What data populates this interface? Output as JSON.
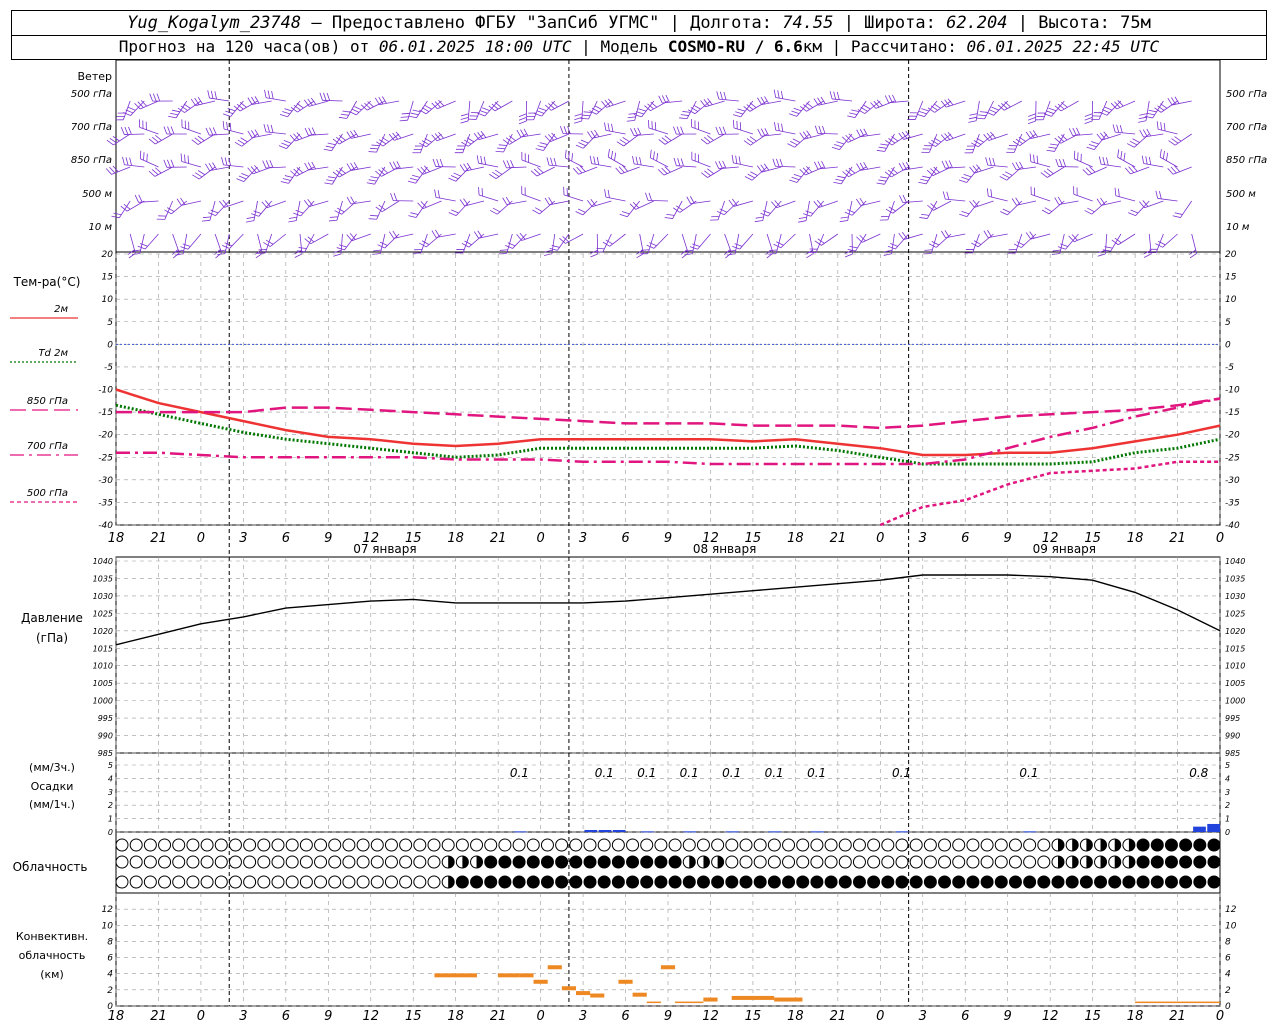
{
  "header": {
    "station": "Yug_Kogalym_23748",
    "dash": "–",
    "provider": "Предоставлено ФГБУ \"ЗапСиб УГМС\"",
    "lon_label": "Долгота:",
    "lon": "74.55",
    "lat_label": "Широта:",
    "lat": "62.204",
    "alt_label": "Высота:",
    "alt": "75м",
    "forecast_label": "Прогноз на 120 часа(ов) от",
    "forecast_time": "06.01.2025 18:00 UTC",
    "model_label": "Модель",
    "model": "COSMO-RU / 6.6",
    "model_unit": "км",
    "calc_label": "Рассчитано:",
    "calc_time": "06.01.2025 22:45 UTC"
  },
  "colors": {
    "temp_2m": "#ee3333",
    "dewpoint_2m": "#007700",
    "temp_upper": "#e0157f",
    "wind": "#7a2fd0",
    "pressure": "#000000",
    "precip": "#2244dd",
    "convective": "#ee8822",
    "zero_line": "#3355cc",
    "grid": "#999999"
  },
  "chart_data": [
    {
      "type": "wind_barbs",
      "title": "Ветер",
      "levels": [
        "500 гПа",
        "700 гПа",
        "850 гПа",
        "500 м",
        "10 м"
      ]
    },
    {
      "type": "line",
      "title": "Тем-ра(°C)",
      "ylim": [
        -40,
        20
      ],
      "yticks": [
        20,
        15,
        10,
        5,
        0,
        -5,
        -10,
        -15,
        -20,
        -25,
        -30,
        -35,
        -40
      ],
      "xticks": [
        "18",
        "21",
        "0",
        "3",
        "6",
        "9",
        "12",
        "15",
        "18",
        "21",
        "0",
        "3",
        "6",
        "9",
        "12",
        "15",
        "18",
        "21",
        "0",
        "3",
        "6",
        "9",
        "12",
        "15",
        "18",
        "21",
        "0"
      ],
      "date_labels": [
        "07 января",
        "08 января",
        "09 января"
      ],
      "x_hours": [
        0,
        3,
        6,
        9,
        12,
        15,
        18,
        21,
        24,
        27,
        30,
        33,
        36,
        39,
        42,
        45,
        48,
        51,
        54,
        57,
        60,
        63,
        66,
        69,
        72,
        75,
        78
      ],
      "series": [
        {
          "name": "2м",
          "style": "solid",
          "values": [
            -10,
            -13,
            -15,
            -17,
            -19,
            -20.5,
            -21,
            -22,
            -22.5,
            -22,
            -21,
            -21,
            -21,
            -21,
            -21,
            -21.5,
            -21,
            -22,
            -23,
            -24.5,
            -24.5,
            -24,
            -24,
            -23,
            -21.5,
            -20,
            -18
          ]
        },
        {
          "name": "Td 2м",
          "style": "dotted",
          "values": [
            -13.5,
            -15.5,
            -17.5,
            -19.5,
            -21,
            -22,
            -23,
            -24,
            -25,
            -24.5,
            -23,
            -23,
            -23,
            -23,
            -23,
            -23,
            -22.5,
            -23.5,
            -25,
            -26.5,
            -26.5,
            -26.5,
            -26.5,
            -26,
            -24,
            -23,
            -21
          ]
        },
        {
          "name": "850 гПа",
          "style": "dashed",
          "values": [
            -15,
            -15,
            -15,
            -15,
            -14,
            -14,
            -14.5,
            -15,
            -15.5,
            -16,
            -16.5,
            -17,
            -17.5,
            -17.5,
            -17.5,
            -18,
            -18,
            -18,
            -18.5,
            -18,
            -17,
            -16,
            -15.5,
            -15,
            -14.5,
            -13.5,
            -12
          ]
        },
        {
          "name": "700 гПа",
          "style": "dashdot",
          "values": [
            -24,
            -24,
            -24.5,
            -25,
            -25,
            -25,
            -25,
            -25,
            -25.5,
            -25.5,
            -25.5,
            -26,
            -26,
            -26,
            -26.5,
            -26.5,
            -26.5,
            -26.5,
            -26.5,
            -26.5,
            -25.5,
            -23,
            -20.5,
            -18.5,
            -16,
            -14,
            -12
          ]
        },
        {
          "name": "500 гПа",
          "style": "shortdash",
          "values": [
            null,
            null,
            null,
            null,
            null,
            null,
            null,
            null,
            null,
            null,
            null,
            null,
            null,
            null,
            null,
            null,
            null,
            null,
            -40,
            -36,
            -34.5,
            -31,
            -28.5,
            -28,
            -27.5,
            -26,
            -26
          ]
        }
      ]
    },
    {
      "type": "line",
      "title": "Давление",
      "unit": "(гПа)",
      "ylim": [
        985,
        1040
      ],
      "yticks": [
        1040,
        1035,
        1030,
        1025,
        1020,
        1015,
        1010,
        1005,
        1000,
        995,
        990,
        985
      ],
      "x_hours": [
        0,
        3,
        6,
        9,
        12,
        15,
        18,
        21,
        24,
        27,
        30,
        33,
        36,
        39,
        42,
        45,
        48,
        51,
        54,
        57,
        60,
        63,
        66,
        69,
        72,
        75,
        78
      ],
      "values": [
        1016,
        1019,
        1022,
        1024,
        1026.5,
        1027.5,
        1028.5,
        1029,
        1028,
        1028,
        1028,
        1028,
        1028.5,
        1029.5,
        1030.5,
        1031.5,
        1032.5,
        1033.5,
        1034.5,
        1036,
        1036,
        1036,
        1035.5,
        1034.5,
        1031,
        1026,
        1020
      ]
    },
    {
      "type": "bar",
      "title": "Осадки",
      "unit_top": "(мм/3ч.)",
      "unit_bottom": "(мм/1ч.)",
      "ylim": [
        0,
        5
      ],
      "yticks": [
        5,
        4,
        3,
        2,
        1,
        0
      ],
      "labels": [
        "0.1",
        "0.1",
        "0.1",
        "0.1",
        "0.1",
        "0.1",
        "0.1",
        "0.1",
        "0.1",
        "0.8"
      ],
      "label_hours": [
        28.5,
        34.5,
        37.5,
        40.5,
        43.5,
        46.5,
        49.5,
        55.5,
        64.5,
        76.5
      ],
      "bars": [
        {
          "hour": 29,
          "value": 0.05
        },
        {
          "hour": 34,
          "value": 0.15
        },
        {
          "hour": 35,
          "value": 0.15
        },
        {
          "hour": 36,
          "value": 0.15
        },
        {
          "hour": 38,
          "value": 0.05
        },
        {
          "hour": 41,
          "value": 0.05
        },
        {
          "hour": 44,
          "value": 0.05
        },
        {
          "hour": 47,
          "value": 0.05
        },
        {
          "hour": 50,
          "value": 0.05
        },
        {
          "hour": 56,
          "value": 0.05
        },
        {
          "hour": 65,
          "value": 0.05
        },
        {
          "hour": 77,
          "value": 0.4
        },
        {
          "hour": 78,
          "value": 0.6
        }
      ]
    },
    {
      "type": "cloud_cover",
      "title": "Облачность",
      "rows": [
        {
          "level": "upper",
          "segments": [
            {
              "from": 0,
              "to": 66,
              "octas": 0
            },
            {
              "from": 66,
              "to": 72,
              "octas": 4
            },
            {
              "from": 72,
              "to": 78,
              "octas": 8
            }
          ]
        },
        {
          "level": "middle",
          "segments": [
            {
              "from": 0,
              "to": 23,
              "octas": 0
            },
            {
              "from": 23,
              "to": 26,
              "octas": 4
            },
            {
              "from": 26,
              "to": 40,
              "octas": 8
            },
            {
              "from": 40,
              "to": 43,
              "octas": 4
            },
            {
              "from": 43,
              "to": 66,
              "octas": 0
            },
            {
              "from": 66,
              "to": 72,
              "octas": 4
            },
            {
              "from": 72,
              "to": 78,
              "octas": 8
            }
          ]
        },
        {
          "level": "lower",
          "segments": [
            {
              "from": 0,
              "to": 23,
              "octas": 0
            },
            {
              "from": 23,
              "to": 24,
              "octas": 4
            },
            {
              "from": 24,
              "to": 78,
              "octas": 8
            }
          ]
        }
      ]
    },
    {
      "type": "range_bar",
      "title": "Конвективн. облачность",
      "unit": "(км)",
      "ylim": [
        0,
        14
      ],
      "yticks": [
        12,
        10,
        8,
        6,
        4,
        2,
        0
      ],
      "segments": [
        {
          "from": 22.5,
          "to": 25.5,
          "value": 3.8
        },
        {
          "from": 27,
          "to": 28.5,
          "value": 3.8
        },
        {
          "from": 28.5,
          "to": 29.5,
          "value": 3.8
        },
        {
          "from": 29.5,
          "to": 30.5,
          "value": 3.0
        },
        {
          "from": 30.5,
          "to": 31.5,
          "value": 4.8
        },
        {
          "from": 31.5,
          "to": 32.5,
          "value": 2.2
        },
        {
          "from": 32.5,
          "to": 33.5,
          "value": 1.6
        },
        {
          "from": 33.5,
          "to": 34.5,
          "value": 1.3
        },
        {
          "from": 35.5,
          "to": 36.5,
          "value": 3.0
        },
        {
          "from": 36.5,
          "to": 37.5,
          "value": 1.4
        },
        {
          "from": 37.5,
          "to": 38.5,
          "value": 0.3
        },
        {
          "from": 38.5,
          "to": 39.5,
          "value": 4.8
        },
        {
          "from": 39.5,
          "to": 41.5,
          "value": 0.3
        },
        {
          "from": 41.5,
          "to": 42.5,
          "value": 0.8
        },
        {
          "from": 43.5,
          "to": 46.5,
          "value": 1.0
        },
        {
          "from": 46.5,
          "to": 48.5,
          "value": 0.8
        },
        {
          "from": 72,
          "to": 78,
          "value": 0.3
        }
      ]
    }
  ]
}
